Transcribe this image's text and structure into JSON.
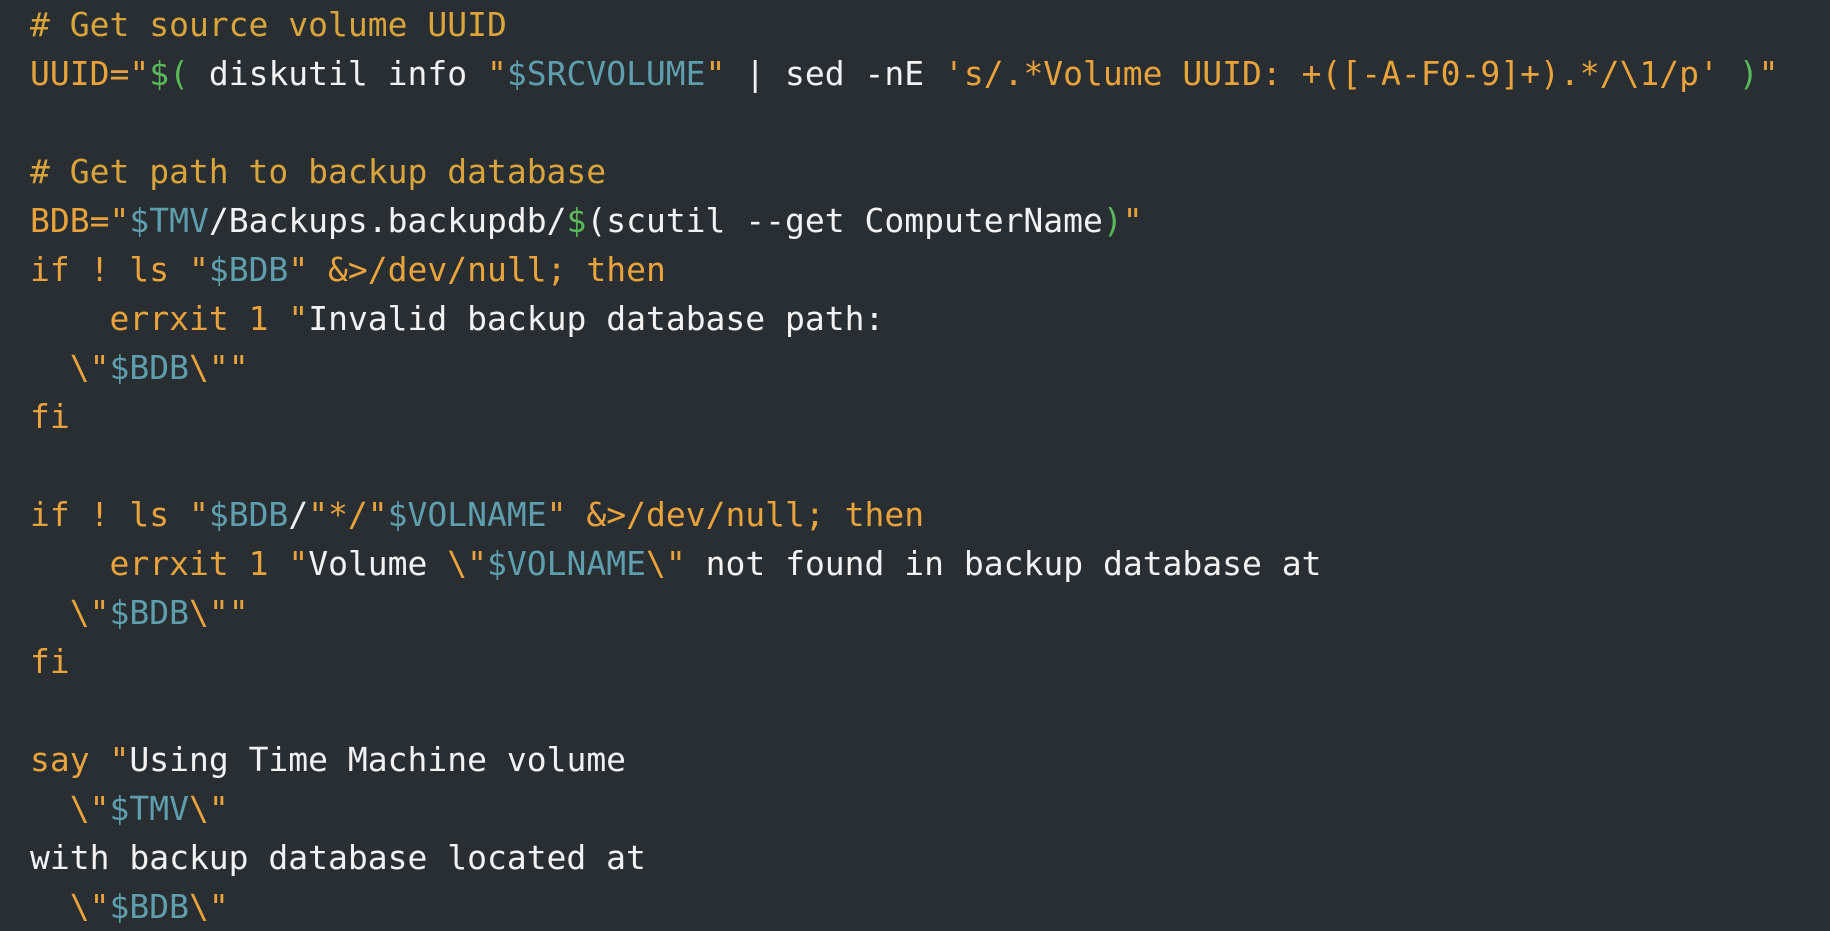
{
  "editor": {
    "title": "bash-script-viewer",
    "language": "bash",
    "theme": "dark",
    "colors": {
      "background": "#282e31",
      "foreground": "#f2f2f2",
      "comment": "#d9a43c",
      "keyword": "#e8a33d",
      "string": "#e8a33d",
      "variable": "#5f9ead",
      "substitution": "#5bb85b"
    },
    "font_size_px": 33,
    "line_height_px": 49
  },
  "lines": [
    {
      "id": "line-1",
      "tokens": [
        {
          "t": "comment",
          "s": "# Get source volume UUID"
        }
      ]
    },
    {
      "id": "line-2",
      "tokens": [
        {
          "t": "keyword",
          "s": "UUID="
        },
        {
          "t": "string",
          "s": "\""
        },
        {
          "t": "subst",
          "s": "$("
        },
        {
          "t": "plain",
          "s": " diskutil info "
        },
        {
          "t": "string",
          "s": "\""
        },
        {
          "t": "var",
          "s": "$SRCVOLUME"
        },
        {
          "t": "string",
          "s": "\""
        },
        {
          "t": "plain",
          "s": " | sed -nE "
        },
        {
          "t": "string",
          "s": "'s/.*Volume UUID: +([-A-F0-9]+).*/\\1/p'"
        },
        {
          "t": "plain",
          "s": " "
        },
        {
          "t": "subst",
          "s": ")"
        },
        {
          "t": "string",
          "s": "\""
        }
      ]
    },
    {
      "id": "line-3",
      "tokens": [
        {
          "t": "plain",
          "s": ""
        }
      ]
    },
    {
      "id": "line-4",
      "tokens": [
        {
          "t": "comment",
          "s": "# Get path to backup database"
        }
      ]
    },
    {
      "id": "line-5",
      "tokens": [
        {
          "t": "keyword",
          "s": "BDB="
        },
        {
          "t": "string",
          "s": "\""
        },
        {
          "t": "var",
          "s": "$TMV"
        },
        {
          "t": "plain",
          "s": "/Backups.backupdb/"
        },
        {
          "t": "subst",
          "s": "$"
        },
        {
          "t": "plain",
          "s": "(scutil --get ComputerName"
        },
        {
          "t": "subst",
          "s": ")"
        },
        {
          "t": "string",
          "s": "\""
        }
      ]
    },
    {
      "id": "line-6",
      "tokens": [
        {
          "t": "keyword",
          "s": "if ! ls "
        },
        {
          "t": "string",
          "s": "\""
        },
        {
          "t": "var",
          "s": "$BDB"
        },
        {
          "t": "string",
          "s": "\""
        },
        {
          "t": "op",
          "s": " &>/dev/null; then"
        }
      ]
    },
    {
      "id": "line-7",
      "tokens": [
        {
          "t": "plain",
          "s": "    "
        },
        {
          "t": "builtin",
          "s": "errxit"
        },
        {
          "t": "plain",
          "s": " "
        },
        {
          "t": "num",
          "s": "1"
        },
        {
          "t": "plain",
          "s": " "
        },
        {
          "t": "string",
          "s": "\""
        },
        {
          "t": "plain",
          "s": "Invalid backup database path:"
        }
      ]
    },
    {
      "id": "line-8",
      "tokens": [
        {
          "t": "plain",
          "s": "  "
        },
        {
          "t": "string",
          "s": "\\\""
        },
        {
          "t": "var",
          "s": "$BDB"
        },
        {
          "t": "string",
          "s": "\\\"\""
        }
      ]
    },
    {
      "id": "line-9",
      "tokens": [
        {
          "t": "keyword",
          "s": "fi"
        }
      ]
    },
    {
      "id": "line-10",
      "tokens": [
        {
          "t": "plain",
          "s": ""
        }
      ]
    },
    {
      "id": "line-11",
      "tokens": [
        {
          "t": "keyword",
          "s": "if ! ls "
        },
        {
          "t": "string",
          "s": "\""
        },
        {
          "t": "var",
          "s": "$BDB"
        },
        {
          "t": "plain",
          "s": "/"
        },
        {
          "t": "string",
          "s": "\"*/\""
        },
        {
          "t": "var",
          "s": "$VOLNAME"
        },
        {
          "t": "string",
          "s": "\""
        },
        {
          "t": "op",
          "s": " &>/dev/null; then"
        }
      ]
    },
    {
      "id": "line-12",
      "tokens": [
        {
          "t": "plain",
          "s": "    "
        },
        {
          "t": "builtin",
          "s": "errxit"
        },
        {
          "t": "plain",
          "s": " "
        },
        {
          "t": "num",
          "s": "1"
        },
        {
          "t": "plain",
          "s": " "
        },
        {
          "t": "string",
          "s": "\""
        },
        {
          "t": "plain",
          "s": "Volume "
        },
        {
          "t": "string",
          "s": "\\\""
        },
        {
          "t": "var",
          "s": "$VOLNAME"
        },
        {
          "t": "string",
          "s": "\\\""
        },
        {
          "t": "plain",
          "s": " not found in backup database at"
        }
      ]
    },
    {
      "id": "line-13",
      "tokens": [
        {
          "t": "plain",
          "s": "  "
        },
        {
          "t": "string",
          "s": "\\\""
        },
        {
          "t": "var",
          "s": "$BDB"
        },
        {
          "t": "string",
          "s": "\\\"\""
        }
      ]
    },
    {
      "id": "line-14",
      "tokens": [
        {
          "t": "keyword",
          "s": "fi"
        }
      ]
    },
    {
      "id": "line-15",
      "tokens": [
        {
          "t": "plain",
          "s": ""
        }
      ]
    },
    {
      "id": "line-16",
      "tokens": [
        {
          "t": "builtin",
          "s": "say"
        },
        {
          "t": "plain",
          "s": " "
        },
        {
          "t": "string",
          "s": "\""
        },
        {
          "t": "plain",
          "s": "Using Time Machine volume"
        }
      ]
    },
    {
      "id": "line-17",
      "tokens": [
        {
          "t": "plain",
          "s": "  "
        },
        {
          "t": "string",
          "s": "\\\""
        },
        {
          "t": "var",
          "s": "$TMV"
        },
        {
          "t": "string",
          "s": "\\\""
        }
      ]
    },
    {
      "id": "line-18",
      "tokens": [
        {
          "t": "plain",
          "s": "with backup database located at"
        }
      ]
    },
    {
      "id": "line-19",
      "tokens": [
        {
          "t": "plain",
          "s": "  "
        },
        {
          "t": "string",
          "s": "\\\""
        },
        {
          "t": "var",
          "s": "$BDB"
        },
        {
          "t": "string",
          "s": "\\\""
        }
      ]
    }
  ]
}
